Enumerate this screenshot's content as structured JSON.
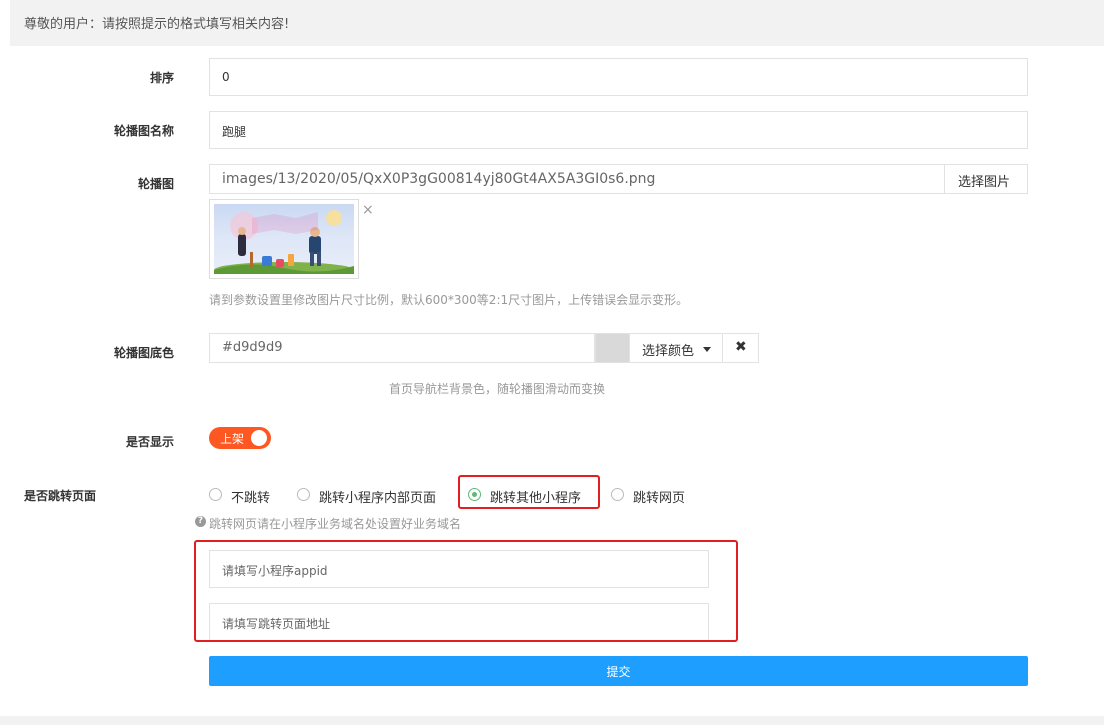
{
  "notice": "尊敬的用户：请按照提示的格式填写相关内容!",
  "form": {
    "sort": {
      "label": "排序",
      "value": "0"
    },
    "banner_name": {
      "label": "轮播图名称",
      "value": "跑腿"
    },
    "banner_image": {
      "label": "轮播图",
      "path": "images/13/2020/05/QxX0P3gG00814yj80Gt4AX5A3GI0s6.png",
      "pick_button": "选择图片",
      "remove_icon": "×",
      "hint": "请到参数设置里修改图片尺寸比例，默认600*300等2:1尺寸图片，上传错误会显示变形。"
    },
    "banner_bg_color": {
      "label": "轮播图底色",
      "value": "#d9d9d9",
      "swatch_color": "#d9d9d9",
      "pick_color_button": "选择颜色",
      "clear_icon": "✖",
      "hint": "首页导航栏背景色，随轮播图滑动而变换"
    },
    "show": {
      "label": "是否显示",
      "switch_text": "上架",
      "on": true,
      "color": "#ff5722"
    },
    "jump": {
      "label": "是否跳转页面",
      "options": [
        "不跳转",
        "跳转小程序内部页面",
        "跳转其他小程序",
        "跳转网页"
      ],
      "selected": "跳转其他小程序",
      "help_icon": "?",
      "hint": "跳转网页请在小程序业务域名处设置好业务域名",
      "appid_placeholder": "请填写小程序appid",
      "path_placeholder": "请填写跳转页面地址"
    },
    "submit": "提交"
  },
  "colors": {
    "primary": "#1e9fff",
    "accent": "#ff5722",
    "radio_checked": "#5fb878",
    "highlight": "#e02020"
  }
}
